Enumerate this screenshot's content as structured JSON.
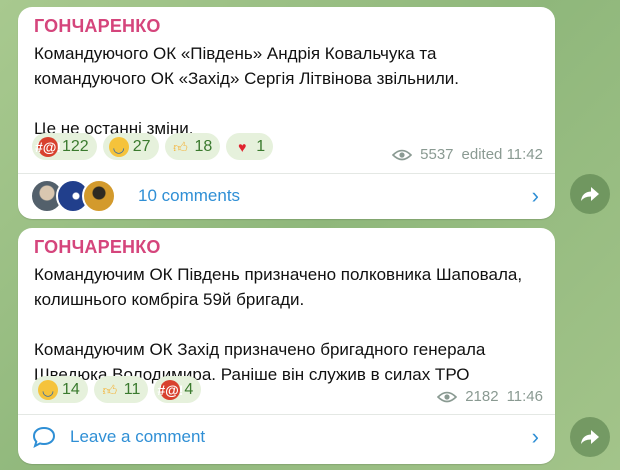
{
  "messages": [
    {
      "author": "ГОНЧАРЕНКО",
      "text": [
        "Командуючого ОК «Південь» Андрія Ковальчука та командуючого ОК «Захід» Сергія Літвінова звільнили.",
        "Це не останні зміни."
      ],
      "reactions": [
        {
          "icon": "angry-face-icon",
          "count": "122"
        },
        {
          "icon": "crying-face-icon",
          "count": "27"
        },
        {
          "icon": "thumbs-up-icon",
          "count": "18"
        },
        {
          "icon": "heart-icon",
          "count": "1"
        }
      ],
      "views": "5537",
      "time": "edited 11:42",
      "comments_label": "10 comments"
    },
    {
      "author": "ГОНЧАРЕНКО",
      "text": [
        "Командуючим ОК Південь призначено полковника Шаповала, колишнього комбріга 59й бригади.",
        "Командуючим ОК Захід призначено бригадного генерала Шведюка Володимира. Раніше він служив в силах ТРО"
      ],
      "reactions": [
        {
          "icon": "crying-face-icon",
          "count": "14"
        },
        {
          "icon": "thumbs-up-icon",
          "count": "11"
        },
        {
          "icon": "angry-face-icon",
          "count": "4"
        }
      ],
      "views": "2182",
      "time": "11:46",
      "comments_label": "Leave a comment"
    }
  ],
  "colors": {
    "author": "#d5457c",
    "link": "#2f8fd5",
    "reaction_bg": "#e6f1dc",
    "reaction_text": "#3a7a2e"
  }
}
